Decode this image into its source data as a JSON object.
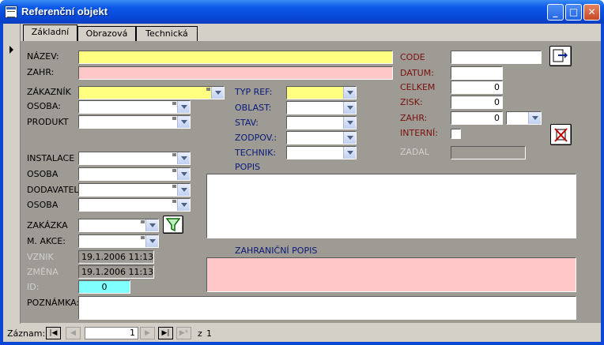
{
  "window": {
    "title": "Referenční objekt"
  },
  "tabs": [
    {
      "label": "Základní"
    },
    {
      "label": "Obrazová"
    },
    {
      "label": "Technická"
    }
  ],
  "left": {
    "nazev_label": "NÁZEV:",
    "nazev_value": "",
    "zahr_label": "ZAHR:",
    "zahr_value": "",
    "zakaznik_label": "ZÁKAZNÍK",
    "osoba1_label": "OSOBA:",
    "produkt_label": "PRODUKT",
    "instalace_label": "INSTALACE",
    "osoba2_label": "OSOBA",
    "dodavatel_label": "DODAVATEL",
    "osoba3_label": "OSOBA",
    "zakazka_label": "ZAKÁZKA",
    "makce_label": "M. AKCE:",
    "vznik_label": "VZNIK",
    "vznik_value": "19.1.2006 11:13",
    "zmena_label": "ZMĚNA",
    "zmena_value": "19.1.2006 11:13",
    "id_label": "ID:",
    "id_value": "0",
    "poznamka_label": "POZNÁMKA:"
  },
  "middle": {
    "typref_label": "TYP REF:",
    "oblast_label": "OBLAST:",
    "stav_label": "STAV:",
    "zodpov_label": "ZODPOV.:",
    "technik_label": "TECHNIK:",
    "popis_label": "POPIS",
    "zahr_popis_label": "ZAHRANIČNÍ POPIS"
  },
  "right": {
    "code_label": "CODE",
    "datum_label": "DATUM:",
    "celkem_label": "CELKEM",
    "celkem_value": "0",
    "zisk_label": "ZISK:",
    "zisk_value": "0",
    "zahr_label": "ZAHR:",
    "zahr_value": "0",
    "interni_label": "INTERNÍ:",
    "zadal_label": "ZADAL"
  },
  "nav": {
    "record_label": "Záznam:",
    "current": "1",
    "of_label": "z",
    "total": "1"
  },
  "colors": {
    "title_blue": "#0a47d6",
    "form_grey": "#9d9b93",
    "required_yellow": "#ffff80",
    "foreign_pink": "#ffc8c8",
    "id_cyan": "#80ffff"
  }
}
